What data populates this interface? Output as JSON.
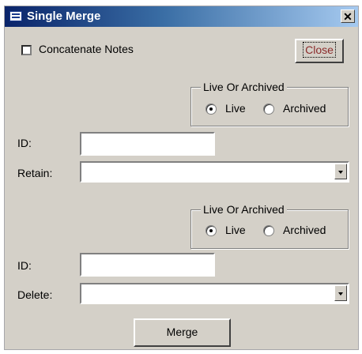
{
  "window": {
    "title": "Single Merge"
  },
  "options": {
    "concatenate_label": "Concatenate Notes",
    "concatenate_checked": false
  },
  "buttons": {
    "close_label": "Close",
    "merge_label": "Merge"
  },
  "retain_section": {
    "group_label": "Live Or Archived",
    "radio_live": "Live",
    "radio_archived": "Archived",
    "selected": "Live",
    "id_label": "ID:",
    "id_value": "",
    "retain_label": "Retain:",
    "retain_value": ""
  },
  "delete_section": {
    "group_label": "Live Or Archived",
    "radio_live": "Live",
    "radio_archived": "Archived",
    "selected": "Live",
    "id_label": "ID:",
    "id_value": "",
    "delete_label": "Delete:",
    "delete_value": ""
  }
}
